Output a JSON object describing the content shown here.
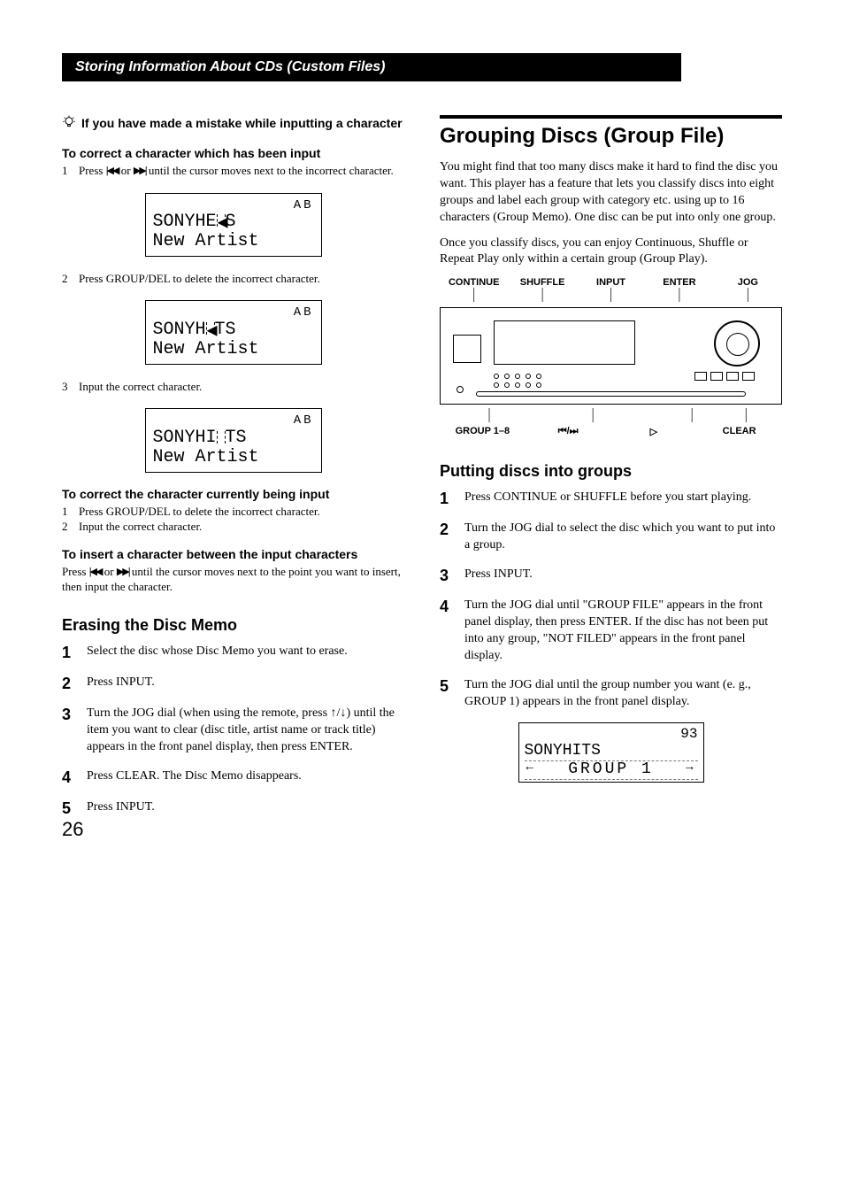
{
  "page_number": "26",
  "section_bar": "Storing Information About CDs (Custom Files)",
  "left": {
    "tip_heading": "If you have made a mistake while inputting a character",
    "sub1": "To correct a character which has been input",
    "step1a_num": "1",
    "step1a_pre": "Press ",
    "step1a_mid": " or ",
    "step1a_post": " until the cursor moves next to the incorrect character.",
    "disp1": {
      "ab": "AB",
      "line1": "SONYHE S",
      "line2": "New Artist"
    },
    "step1b_num": "2",
    "step1b": "Press GROUP/DEL to delete the incorrect character.",
    "disp2": {
      "ab": "AB",
      "line1": "SONYH TS",
      "line2": "New Artist"
    },
    "step1c_num": "3",
    "step1c": "Input the correct character.",
    "disp3": {
      "ab": "AB",
      "line1": "SONYHITS",
      "line2": "New Artist"
    },
    "sub2": "To correct the character currently being input",
    "s2a_num": "1",
    "s2a": "Press GROUP/DEL to delete the incorrect character.",
    "s2b_num": "2",
    "s2b": "Input the correct character.",
    "sub3": "To insert a character between the input characters",
    "s3_pre": "Press ",
    "s3_mid": " or ",
    "s3_post": " until the cursor moves next to the point you want to insert, then input the character.",
    "h2": "Erasing the Disc Memo",
    "erase": [
      {
        "n": "1",
        "t": "Select the disc whose Disc Memo you want to erase."
      },
      {
        "n": "2",
        "t": "Press INPUT."
      },
      {
        "n": "3",
        "t": "Turn the JOG dial (when using the remote, press ↑/↓) until the item you want to clear (disc title, artist name or track title) appears in the front panel display, then press ENTER."
      },
      {
        "n": "4",
        "t": "Press CLEAR.\nThe Disc Memo disappears."
      },
      {
        "n": "5",
        "t": "Press INPUT."
      }
    ]
  },
  "right": {
    "title": "Grouping Discs (Group File)",
    "para1": "You might find that too many discs make it hard to find the disc you want. This player has a feature that lets you classify discs into eight groups and label each group with category etc. using up to 16 characters (Group Memo). One disc can be put into only one group.",
    "para2": "Once you classify discs, you can enjoy Continuous, Shuffle or Repeat Play only within a certain group (Group Play).",
    "labels_top": [
      "CONTINUE",
      "SHUFFLE",
      "INPUT",
      "ENTER",
      "JOG"
    ],
    "labels_bot": [
      "GROUP 1–8",
      "⏮/⏭",
      "▷",
      "CLEAR"
    ],
    "h2": "Putting discs into groups",
    "steps": [
      {
        "n": "1",
        "t": "Press CONTINUE or SHUFFLE before you start playing."
      },
      {
        "n": "2",
        "t": "Turn the JOG dial to select the disc which you want to put into a group."
      },
      {
        "n": "3",
        "t": "Press INPUT."
      },
      {
        "n": "4",
        "t": "Turn the JOG dial until \"GROUP FILE\" appears in the front panel display, then press ENTER.\nIf the disc has not been put into any group, \"NOT FILED\" appears in the front panel display."
      },
      {
        "n": "5",
        "t": "Turn the JOG dial until the group number you want (e. g., GROUP 1) appears in the front panel display."
      }
    ],
    "group_display": {
      "num": "93",
      "line1": "SONYHITS",
      "line2": "GROUP 1"
    }
  }
}
